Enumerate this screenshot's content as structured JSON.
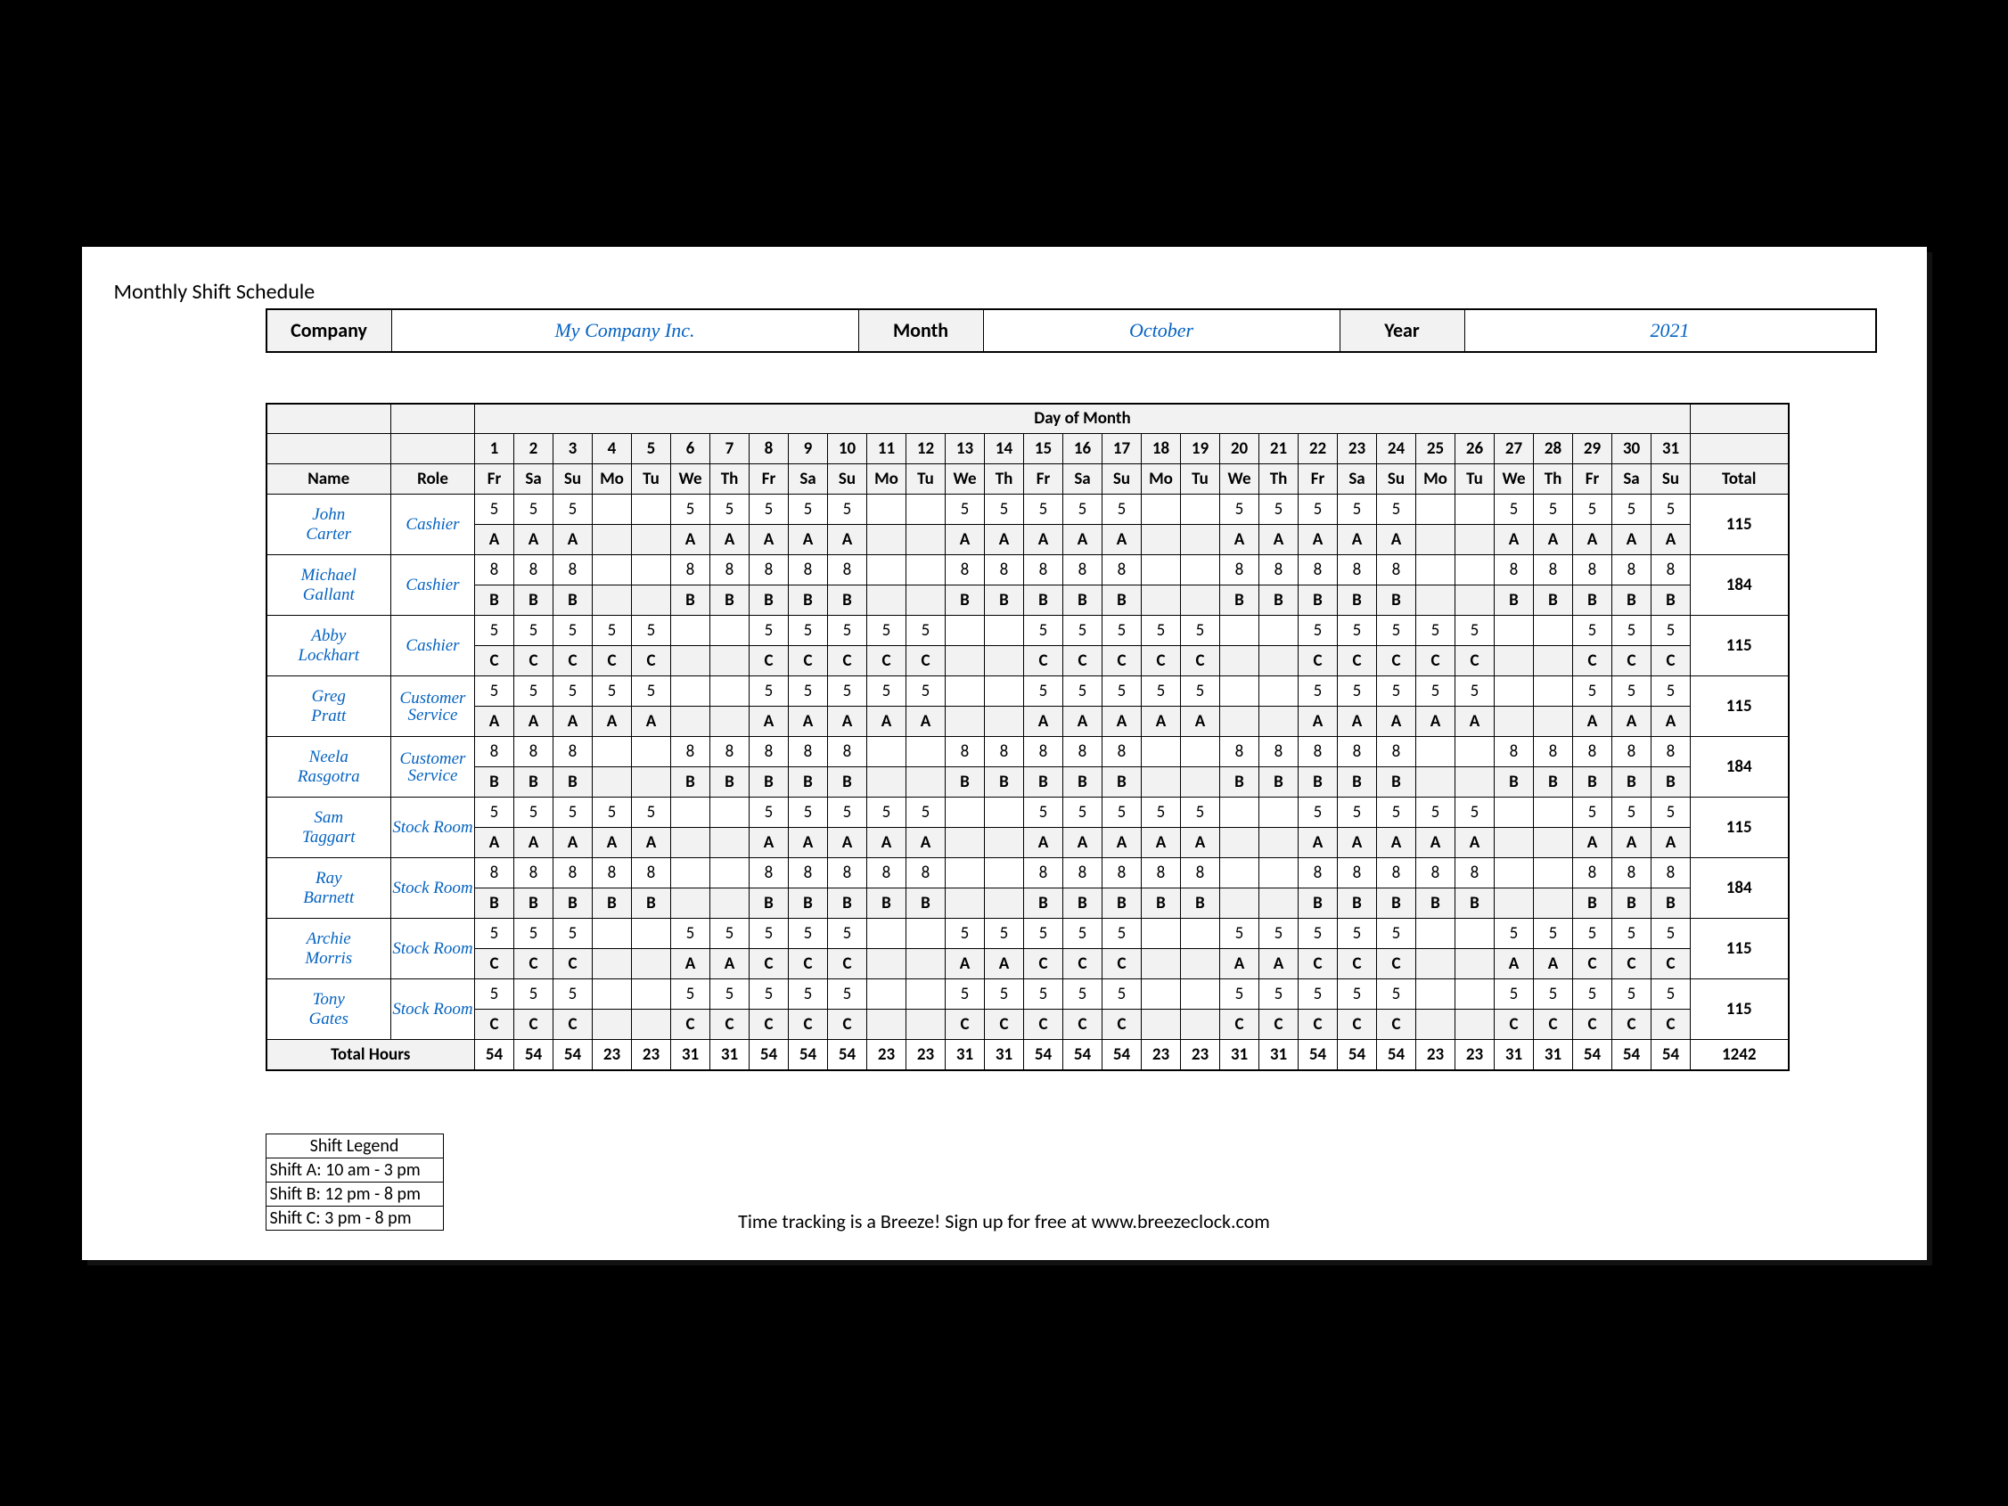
{
  "title": "Monthly Shift Schedule",
  "header": {
    "company_label": "Company",
    "company": "My Company Inc.",
    "month_label": "Month",
    "month": "October",
    "year_label": "Year",
    "year": "2021"
  },
  "columns": {
    "name": "Name",
    "role": "Role",
    "day_of_month": "Day of Month",
    "total": "Total"
  },
  "days": {
    "nums": [
      "1",
      "2",
      "3",
      "4",
      "5",
      "6",
      "7",
      "8",
      "9",
      "10",
      "11",
      "12",
      "13",
      "14",
      "15",
      "16",
      "17",
      "18",
      "19",
      "20",
      "21",
      "22",
      "23",
      "24",
      "25",
      "26",
      "27",
      "28",
      "29",
      "30",
      "31"
    ],
    "abbr": [
      "Fr",
      "Sa",
      "Su",
      "Mo",
      "Tu",
      "We",
      "Th",
      "Fr",
      "Sa",
      "Su",
      "Mo",
      "Tu",
      "We",
      "Th",
      "Fr",
      "Sa",
      "Su",
      "Mo",
      "Tu",
      "We",
      "Th",
      "Fr",
      "Sa",
      "Su",
      "Mo",
      "Tu",
      "We",
      "Th",
      "Fr",
      "Sa",
      "Su"
    ]
  },
  "employees": [
    {
      "name": "John Carter",
      "role": "Cashier",
      "hours": [
        "5",
        "5",
        "5",
        "",
        "",
        "5",
        "5",
        "5",
        "5",
        "5",
        "",
        "",
        "5",
        "5",
        "5",
        "5",
        "5",
        "",
        "",
        "5",
        "5",
        "5",
        "5",
        "5",
        "",
        "",
        "5",
        "5",
        "5",
        "5",
        "5"
      ],
      "shift": [
        "A",
        "A",
        "A",
        "",
        "",
        "A",
        "A",
        "A",
        "A",
        "A",
        "",
        "",
        "A",
        "A",
        "A",
        "A",
        "A",
        "",
        "",
        "A",
        "A",
        "A",
        "A",
        "A",
        "",
        "",
        "A",
        "A",
        "A",
        "A",
        "A"
      ],
      "total": "115"
    },
    {
      "name": "Michael Gallant",
      "role": "Cashier",
      "hours": [
        "8",
        "8",
        "8",
        "",
        "",
        "8",
        "8",
        "8",
        "8",
        "8",
        "",
        "",
        "8",
        "8",
        "8",
        "8",
        "8",
        "",
        "",
        "8",
        "8",
        "8",
        "8",
        "8",
        "",
        "",
        "8",
        "8",
        "8",
        "8",
        "8"
      ],
      "shift": [
        "B",
        "B",
        "B",
        "",
        "",
        "B",
        "B",
        "B",
        "B",
        "B",
        "",
        "",
        "B",
        "B",
        "B",
        "B",
        "B",
        "",
        "",
        "B",
        "B",
        "B",
        "B",
        "B",
        "",
        "",
        "B",
        "B",
        "B",
        "B",
        "B"
      ],
      "total": "184"
    },
    {
      "name": "Abby Lockhart",
      "role": "Cashier",
      "hours": [
        "5",
        "5",
        "5",
        "5",
        "5",
        "",
        "",
        "5",
        "5",
        "5",
        "5",
        "5",
        "",
        "",
        "5",
        "5",
        "5",
        "5",
        "5",
        "",
        "",
        "5",
        "5",
        "5",
        "5",
        "5",
        "",
        "",
        "5",
        "5",
        "5"
      ],
      "shift": [
        "C",
        "C",
        "C",
        "C",
        "C",
        "",
        "",
        "C",
        "C",
        "C",
        "C",
        "C",
        "",
        "",
        "C",
        "C",
        "C",
        "C",
        "C",
        "",
        "",
        "C",
        "C",
        "C",
        "C",
        "C",
        "",
        "",
        "C",
        "C",
        "C"
      ],
      "total": "115"
    },
    {
      "name": "Greg Pratt",
      "role": "Customer Service",
      "hours": [
        "5",
        "5",
        "5",
        "5",
        "5",
        "",
        "",
        "5",
        "5",
        "5",
        "5",
        "5",
        "",
        "",
        "5",
        "5",
        "5",
        "5",
        "5",
        "",
        "",
        "5",
        "5",
        "5",
        "5",
        "5",
        "",
        "",
        "5",
        "5",
        "5"
      ],
      "shift": [
        "A",
        "A",
        "A",
        "A",
        "A",
        "",
        "",
        "A",
        "A",
        "A",
        "A",
        "A",
        "",
        "",
        "A",
        "A",
        "A",
        "A",
        "A",
        "",
        "",
        "A",
        "A",
        "A",
        "A",
        "A",
        "",
        "",
        "A",
        "A",
        "A"
      ],
      "total": "115"
    },
    {
      "name": "Neela Rasgotra",
      "role": "Customer Service",
      "hours": [
        "8",
        "8",
        "8",
        "",
        "",
        "8",
        "8",
        "8",
        "8",
        "8",
        "",
        "",
        "8",
        "8",
        "8",
        "8",
        "8",
        "",
        "",
        "8",
        "8",
        "8",
        "8",
        "8",
        "",
        "",
        "8",
        "8",
        "8",
        "8",
        "8"
      ],
      "shift": [
        "B",
        "B",
        "B",
        "",
        "",
        "B",
        "B",
        "B",
        "B",
        "B",
        "",
        "",
        "B",
        "B",
        "B",
        "B",
        "B",
        "",
        "",
        "B",
        "B",
        "B",
        "B",
        "B",
        "",
        "",
        "B",
        "B",
        "B",
        "B",
        "B"
      ],
      "total": "184"
    },
    {
      "name": "Sam Taggart",
      "role": "Stock Room",
      "hours": [
        "5",
        "5",
        "5",
        "5",
        "5",
        "",
        "",
        "5",
        "5",
        "5",
        "5",
        "5",
        "",
        "",
        "5",
        "5",
        "5",
        "5",
        "5",
        "",
        "",
        "5",
        "5",
        "5",
        "5",
        "5",
        "",
        "",
        "5",
        "5",
        "5"
      ],
      "shift": [
        "A",
        "A",
        "A",
        "A",
        "A",
        "",
        "",
        "A",
        "A",
        "A",
        "A",
        "A",
        "",
        "",
        "A",
        "A",
        "A",
        "A",
        "A",
        "",
        "",
        "A",
        "A",
        "A",
        "A",
        "A",
        "",
        "",
        "A",
        "A",
        "A"
      ],
      "total": "115"
    },
    {
      "name": "Ray Barnett",
      "role": "Stock Room",
      "hours": [
        "8",
        "8",
        "8",
        "8",
        "8",
        "",
        "",
        "8",
        "8",
        "8",
        "8",
        "8",
        "",
        "",
        "8",
        "8",
        "8",
        "8",
        "8",
        "",
        "",
        "8",
        "8",
        "8",
        "8",
        "8",
        "",
        "",
        "8",
        "8",
        "8"
      ],
      "shift": [
        "B",
        "B",
        "B",
        "B",
        "B",
        "",
        "",
        "B",
        "B",
        "B",
        "B",
        "B",
        "",
        "",
        "B",
        "B",
        "B",
        "B",
        "B",
        "",
        "",
        "B",
        "B",
        "B",
        "B",
        "B",
        "",
        "",
        "B",
        "B",
        "B"
      ],
      "total": "184"
    },
    {
      "name": "Archie Morris",
      "role": "Stock Room",
      "hours": [
        "5",
        "5",
        "5",
        "",
        "",
        "5",
        "5",
        "5",
        "5",
        "5",
        "",
        "",
        "5",
        "5",
        "5",
        "5",
        "5",
        "",
        "",
        "5",
        "5",
        "5",
        "5",
        "5",
        "",
        "",
        "5",
        "5",
        "5",
        "5",
        "5"
      ],
      "shift": [
        "C",
        "C",
        "C",
        "",
        "",
        "A",
        "A",
        "C",
        "C",
        "C",
        "",
        "",
        "A",
        "A",
        "C",
        "C",
        "C",
        "",
        "",
        "A",
        "A",
        "C",
        "C",
        "C",
        "",
        "",
        "A",
        "A",
        "C",
        "C",
        "C"
      ],
      "total": "115"
    },
    {
      "name": "Tony Gates",
      "role": "Stock Room",
      "hours": [
        "5",
        "5",
        "5",
        "",
        "",
        "5",
        "5",
        "5",
        "5",
        "5",
        "",
        "",
        "5",
        "5",
        "5",
        "5",
        "5",
        "",
        "",
        "5",
        "5",
        "5",
        "5",
        "5",
        "",
        "",
        "5",
        "5",
        "5",
        "5",
        "5"
      ],
      "shift": [
        "C",
        "C",
        "C",
        "",
        "",
        "C",
        "C",
        "C",
        "C",
        "C",
        "",
        "",
        "C",
        "C",
        "C",
        "C",
        "C",
        "",
        "",
        "C",
        "C",
        "C",
        "C",
        "C",
        "",
        "",
        "C",
        "C",
        "C",
        "C",
        "C"
      ],
      "total": "115"
    }
  ],
  "totals": {
    "label": "Total Hours",
    "per_day": [
      "54",
      "54",
      "54",
      "23",
      "23",
      "31",
      "31",
      "54",
      "54",
      "54",
      "23",
      "23",
      "31",
      "31",
      "54",
      "54",
      "54",
      "23",
      "23",
      "31",
      "31",
      "54",
      "54",
      "54",
      "23",
      "23",
      "31",
      "31",
      "54",
      "54",
      "54"
    ],
    "grand": "1242"
  },
  "legend": {
    "title": "Shift Legend",
    "items": [
      "Shift A: 10 am - 3 pm",
      "Shift B: 12 pm - 8 pm",
      "Shift C: 3 pm - 8 pm"
    ]
  },
  "footer": "Time tracking is a Breeze! Sign up for free at www.breezeclock.com"
}
